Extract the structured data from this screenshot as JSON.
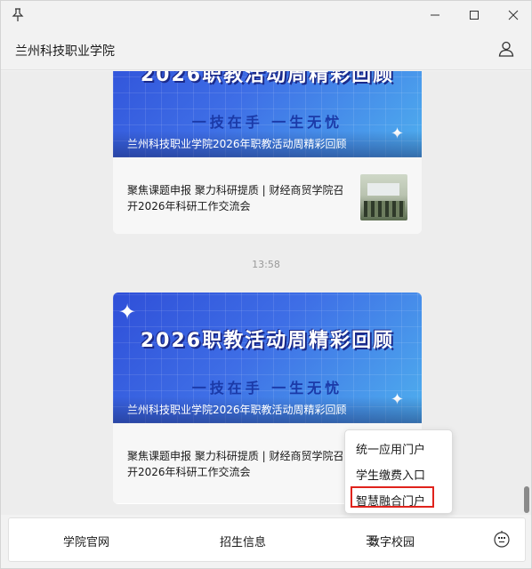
{
  "window": {
    "title_controls": {
      "pin_icon": "pin-icon",
      "minimize_icon": "minimize-icon",
      "maximize_icon": "maximize-icon",
      "close_icon": "close-icon"
    }
  },
  "header": {
    "account_name": "兰州科技职业学院",
    "profile_icon": "profile-icon"
  },
  "messages": [
    {
      "banner_title": "2026职教活动周精彩回顾",
      "banner_slogan": "一技在手  一生无忧",
      "banner_caption": "兰州科技职业学院2026年职教活动周精彩回顾",
      "sub_title": "聚焦课题申报 聚力科研提质 | 财经商贸学院召开2026年科研工作交流会"
    },
    {
      "timestamp": "13:58",
      "banner_title": "2026职教活动周精彩回顾",
      "banner_slogan": "一技在手  一生无忧",
      "banner_caption": "兰州科技职业学院2026年职教活动周精彩回顾",
      "sub_title": "聚焦课题申报 聚力科研提质 | 财经商贸学院召开2026年科研工作交流会"
    }
  ],
  "popup_menu": {
    "items": [
      "统一应用门户",
      "学生缴费入口",
      "智慧融合门户"
    ],
    "highlighted_index": 2
  },
  "bottom_menu": {
    "items": [
      "学院官网",
      "招生信息",
      "数字校园"
    ],
    "menu_icon": "menu-lines-icon",
    "keyboard_icon": "keyboard-icon"
  },
  "colors": {
    "highlight": "#e0231c",
    "banner_start": "#2f4fd8",
    "banner_end": "#4fb0ee"
  }
}
